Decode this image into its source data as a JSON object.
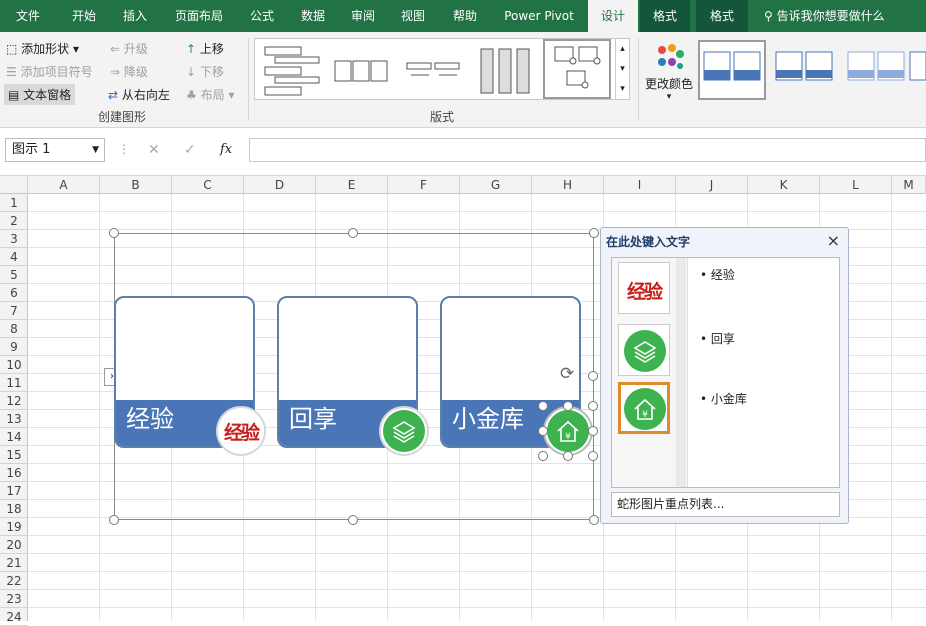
{
  "tabs": [
    {
      "label": "文件"
    },
    {
      "label": "开始"
    },
    {
      "label": "插入"
    },
    {
      "label": "页面布局"
    },
    {
      "label": "公式"
    },
    {
      "label": "数据"
    },
    {
      "label": "审阅"
    },
    {
      "label": "视图"
    },
    {
      "label": "帮助"
    },
    {
      "label": "Power Pivot"
    },
    {
      "label": "设计"
    },
    {
      "label": "格式"
    },
    {
      "label": "格式"
    }
  ],
  "tell_me": "告诉我你想要做什么",
  "create": {
    "add_shape": "添加形状",
    "add_bullet": "添加项目符号",
    "text_pane": "文本窗格",
    "promote": "升级",
    "demote": "降级",
    "rtl": "从右向左",
    "move_up": "上移",
    "move_down": "下移",
    "layout": "布局",
    "group": "创建图形"
  },
  "layouts_group": "版式",
  "change_colors": "更改颜色",
  "name_box": "图示 1",
  "fx": "fx",
  "columns": [
    "A",
    "B",
    "C",
    "D",
    "E",
    "F",
    "G",
    "H",
    "I",
    "J",
    "K",
    "L",
    "M"
  ],
  "rows": [
    "1",
    "2",
    "3",
    "4",
    "5",
    "6",
    "7",
    "8",
    "9",
    "10",
    "11",
    "12",
    "13",
    "14",
    "15",
    "16",
    "17",
    "18",
    "19",
    "20",
    "21",
    "22",
    "23",
    "24"
  ],
  "items": [
    {
      "label": "经验"
    },
    {
      "label": "回享"
    },
    {
      "label": "小金库"
    }
  ],
  "pane": {
    "title": "在此处键入文字",
    "footer": "蛇形图片重点列表...",
    "close": "×"
  },
  "colors": {
    "excel_green": "#217346",
    "card_blue": "#4a76b8",
    "card_border": "#5b7fa8",
    "icon_green": "#3db24e",
    "stamp_red": "#c9201c"
  }
}
